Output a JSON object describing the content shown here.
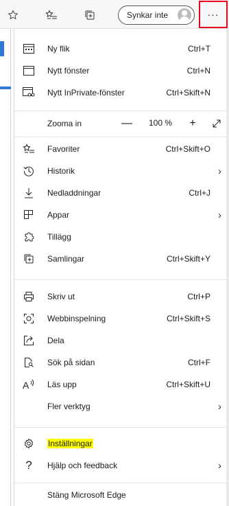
{
  "toolbar": {
    "sync_label": "Synkar inte",
    "more_label": "···",
    "accent_color": "#e8001c"
  },
  "zoom": {
    "label": "Zooma in",
    "value": "100 %",
    "minus": "—",
    "plus": "+"
  },
  "menu": {
    "new_tab": {
      "label": "Ny flik",
      "shortcut": "Ctrl+T"
    },
    "new_window": {
      "label": "Nytt fönster",
      "shortcut": "Ctrl+N"
    },
    "new_private": {
      "label": "Nytt InPrivate-fönster",
      "shortcut": "Ctrl+Skift+N"
    },
    "favorites": {
      "label": "Favoriter",
      "shortcut": "Ctrl+Skift+O"
    },
    "history": {
      "label": "Historik"
    },
    "downloads": {
      "label": "Nedladdningar",
      "shortcut": "Ctrl+J"
    },
    "apps": {
      "label": "Appar"
    },
    "extensions": {
      "label": "Tillägg"
    },
    "collections": {
      "label": "Samlingar",
      "shortcut": "Ctrl+Skift+Y"
    },
    "print": {
      "label": "Skriv ut",
      "shortcut": "Ctrl+P"
    },
    "web_capture": {
      "label": "Webbinspelning",
      "shortcut": "Ctrl+Skift+S"
    },
    "share": {
      "label": "Dela"
    },
    "find": {
      "label": "Sök på sidan",
      "shortcut": "Ctrl+F"
    },
    "read_aloud": {
      "label": "Läs upp",
      "shortcut": "Ctrl+Skift+U"
    },
    "more_tools": {
      "label": "Fler verktyg"
    },
    "settings": {
      "label": "Inställningar",
      "highlight_color": "#ffff00"
    },
    "help": {
      "label": "Hjälp och feedback"
    },
    "close": {
      "label": "Stäng Microsoft Edge"
    }
  }
}
